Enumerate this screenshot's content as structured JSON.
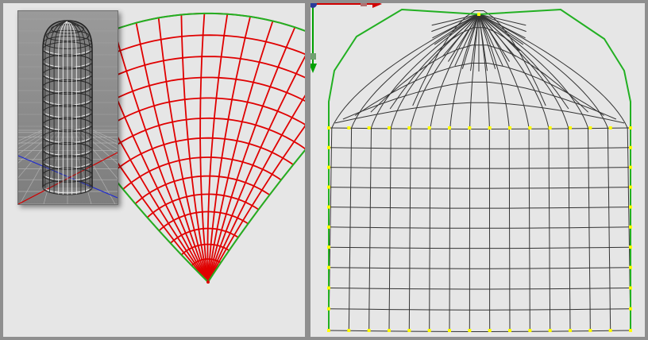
{
  "window": {
    "title": ""
  },
  "colors": {
    "background": "#e6e6e6",
    "frame": "#8f8f8f",
    "uv_grid_left": "#e00000",
    "uv_grid_right": "#333333",
    "seam_border": "#22b022",
    "pinned_vertex": "#ffff00",
    "axis_x": "#d00000",
    "axis_y": "#00a000",
    "axis_z": "#1e2ad0",
    "inset_background": "#8a8a8a",
    "inset_wire": "#f2f2f2"
  },
  "panels": {
    "left": {
      "view": "uv-unwrap-conformal",
      "grid_color": "red"
    },
    "right": {
      "view": "uv-unwrap-pinned-rect",
      "grid_color": "dark-gray"
    },
    "inset": {
      "view": "3d-capsule-mesh",
      "wireframe": true
    }
  },
  "icons": {
    "gizmo_origin": "gizmo-origin-icon",
    "gizmo_x": "x-axis-arrow-icon",
    "gizmo_y": "y-axis-arrow-icon"
  }
}
